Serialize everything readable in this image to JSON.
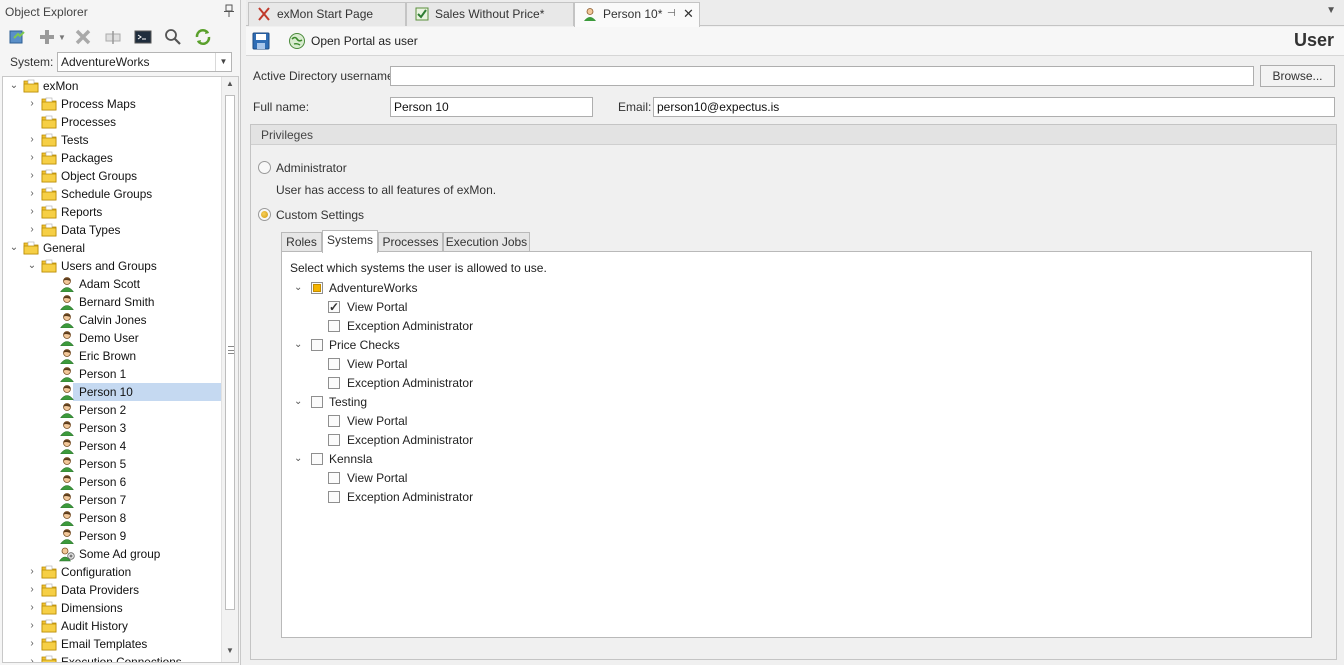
{
  "explorer": {
    "title": "Object Explorer",
    "system_label": "System:",
    "system_value": "AdventureWorks",
    "tree": [
      {
        "label": "exMon",
        "level": 0,
        "expanded": true,
        "icon": "folder-icon"
      },
      {
        "label": "Process Maps",
        "level": 1,
        "expander": "collapsed",
        "icon": "folder-icon"
      },
      {
        "label": "Processes",
        "level": 1,
        "expander": "none",
        "icon": "folder-icon"
      },
      {
        "label": "Tests",
        "level": 1,
        "expander": "collapsed",
        "icon": "folder-icon"
      },
      {
        "label": "Packages",
        "level": 1,
        "expander": "collapsed",
        "icon": "folder-icon"
      },
      {
        "label": "Object Groups",
        "level": 1,
        "expander": "collapsed",
        "icon": "folder-icon"
      },
      {
        "label": "Schedule Groups",
        "level": 1,
        "expander": "collapsed",
        "icon": "folder-icon"
      },
      {
        "label": "Reports",
        "level": 1,
        "expander": "collapsed",
        "icon": "folder-icon"
      },
      {
        "label": "Data Types",
        "level": 1,
        "expander": "collapsed",
        "icon": "folder-icon"
      },
      {
        "label": "General",
        "level": 0,
        "expanded": true,
        "icon": "folder-icon"
      },
      {
        "label": "Users and Groups",
        "level": 1,
        "expanded": true,
        "icon": "folder-icon"
      },
      {
        "label": "Adam Scott",
        "level": 2,
        "expander": "none",
        "icon": "user-icon"
      },
      {
        "label": "Bernard Smith",
        "level": 2,
        "expander": "none",
        "icon": "user-icon"
      },
      {
        "label": "Calvin Jones",
        "level": 2,
        "expander": "none",
        "icon": "user-icon"
      },
      {
        "label": "Demo User",
        "level": 2,
        "expander": "none",
        "icon": "user-icon"
      },
      {
        "label": "Eric Brown",
        "level": 2,
        "expander": "none",
        "icon": "user-icon"
      },
      {
        "label": "Person 1",
        "level": 2,
        "expander": "none",
        "icon": "user-icon"
      },
      {
        "label": "Person 10",
        "level": 2,
        "expander": "none",
        "icon": "user-icon",
        "selected": true
      },
      {
        "label": "Person 2",
        "level": 2,
        "expander": "none",
        "icon": "user-icon"
      },
      {
        "label": "Person 3",
        "level": 2,
        "expander": "none",
        "icon": "user-icon"
      },
      {
        "label": "Person 4",
        "level": 2,
        "expander": "none",
        "icon": "user-icon"
      },
      {
        "label": "Person 5",
        "level": 2,
        "expander": "none",
        "icon": "user-icon"
      },
      {
        "label": "Person 6",
        "level": 2,
        "expander": "none",
        "icon": "user-icon"
      },
      {
        "label": "Person 7",
        "level": 2,
        "expander": "none",
        "icon": "user-icon"
      },
      {
        "label": "Person 8",
        "level": 2,
        "expander": "none",
        "icon": "user-icon"
      },
      {
        "label": "Person 9",
        "level": 2,
        "expander": "none",
        "icon": "user-icon"
      },
      {
        "label": "Some Ad group",
        "level": 2,
        "expander": "none",
        "icon": "group-icon"
      },
      {
        "label": "Configuration",
        "level": 1,
        "expander": "collapsed",
        "icon": "folder-icon"
      },
      {
        "label": "Data Providers",
        "level": 1,
        "expander": "collapsed",
        "icon": "folder-icon"
      },
      {
        "label": "Dimensions",
        "level": 1,
        "expander": "collapsed",
        "icon": "folder-icon"
      },
      {
        "label": "Audit History",
        "level": 1,
        "expander": "collapsed",
        "icon": "folder-icon"
      },
      {
        "label": "Email Templates",
        "level": 1,
        "expander": "collapsed",
        "icon": "folder-icon"
      },
      {
        "label": "Execution Connections",
        "level": 1,
        "expander": "collapsed",
        "icon": "folder-icon"
      }
    ]
  },
  "tabs": [
    {
      "label": "exMon Start Page",
      "icon": "exmon-logo-icon"
    },
    {
      "label": "Sales Without Price*",
      "icon": "checklist-icon"
    },
    {
      "label": "Person 10*",
      "icon": "user-icon",
      "active": true
    }
  ],
  "toolbar": {
    "open_portal_label": "Open Portal as user",
    "page_title": "User"
  },
  "form": {
    "ad_username_label": "Active Directory username:",
    "ad_username_value": "",
    "browse_label": "Browse...",
    "fullname_label": "Full name:",
    "fullname_value": "Person 10",
    "email_label": "Email:",
    "email_value": "person10@expectus.is"
  },
  "privileges": {
    "header": "Privileges",
    "admin_label": "Administrator",
    "admin_desc": "User has access to all features of exMon.",
    "custom_label": "Custom Settings",
    "selected": "custom",
    "tabs": [
      "Roles",
      "Systems",
      "Processes",
      "Execution Jobs"
    ],
    "active_tab": "Systems",
    "systems_instruction": "Select which systems the user is allowed to use.",
    "systems": [
      {
        "name": "AdventureWorks",
        "state": "partial",
        "view_portal": true,
        "exception_admin": false
      },
      {
        "name": "Price Checks",
        "state": "unchecked",
        "view_portal": false,
        "exception_admin": false
      },
      {
        "name": "Testing",
        "state": "unchecked",
        "view_portal": false,
        "exception_admin": false
      },
      {
        "name": "Kennsla",
        "state": "unchecked",
        "view_portal": false,
        "exception_admin": false
      }
    ],
    "view_portal_label": "View Portal",
    "exception_admin_label": "Exception Administrator"
  },
  "colors": {
    "selection": "#c5d9f1",
    "folder": "#f2c230",
    "partial_check": "#f4b400"
  }
}
